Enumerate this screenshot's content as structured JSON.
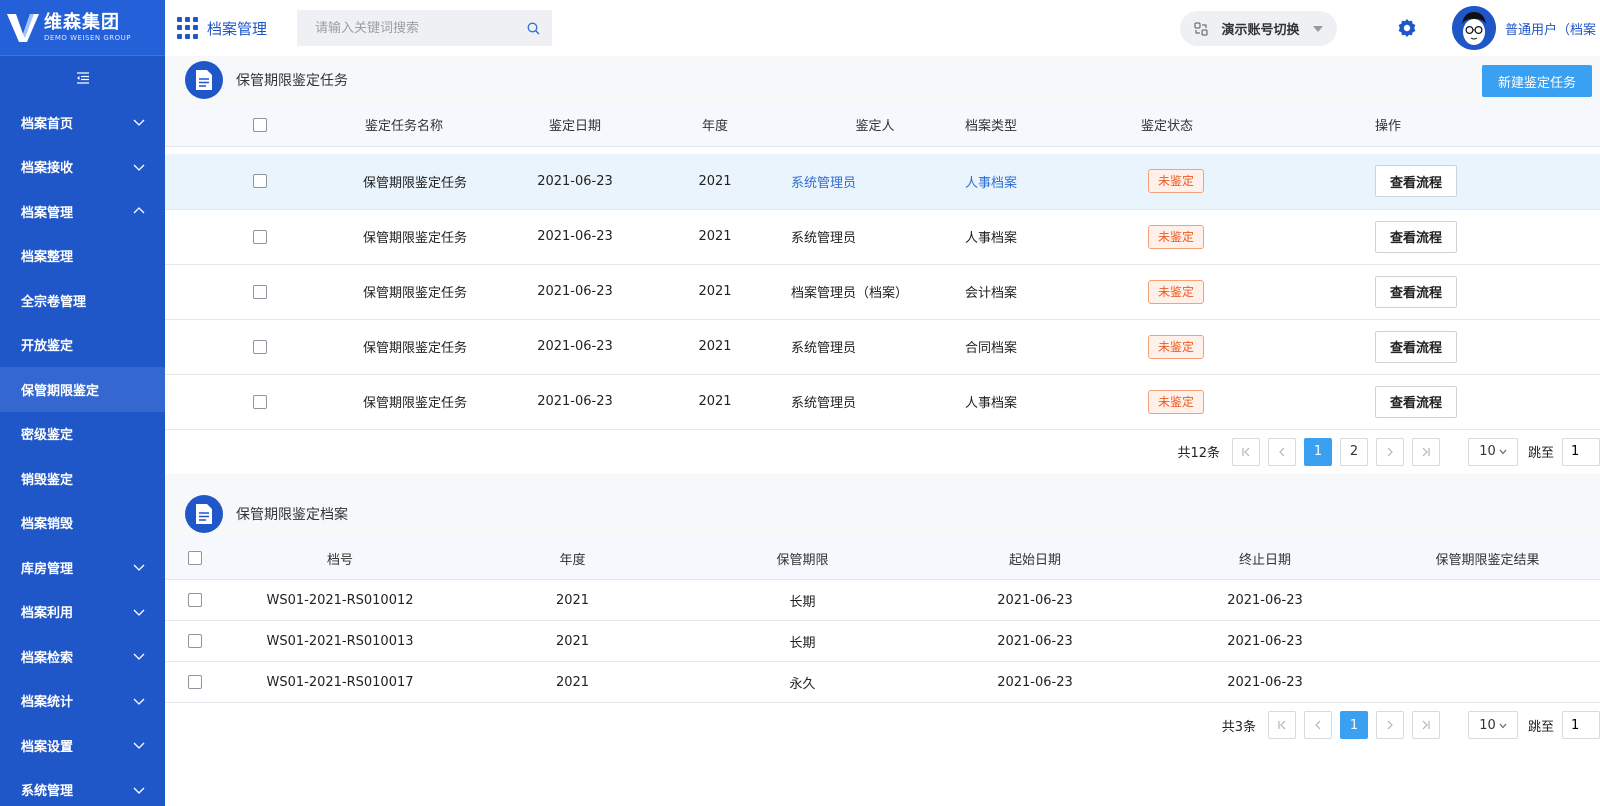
{
  "brand": {
    "name": "维森集团",
    "sub": "DEMO WEISEN GROUP"
  },
  "sidebar": {
    "items": [
      {
        "label": "档案首页",
        "chevron": "down"
      },
      {
        "label": "档案接收",
        "chevron": "down"
      },
      {
        "label": "档案管理",
        "chevron": "up"
      },
      {
        "label": "档案整理",
        "chevron": ""
      },
      {
        "label": "全宗卷管理",
        "chevron": ""
      },
      {
        "label": "开放鉴定",
        "chevron": ""
      },
      {
        "label": "保管期限鉴定",
        "chevron": "",
        "active": true
      },
      {
        "label": "密级鉴定",
        "chevron": ""
      },
      {
        "label": "销毁鉴定",
        "chevron": ""
      },
      {
        "label": "档案销毁",
        "chevron": ""
      },
      {
        "label": "库房管理",
        "chevron": "down"
      },
      {
        "label": "档案利用",
        "chevron": "down"
      },
      {
        "label": "档案检索",
        "chevron": "down"
      },
      {
        "label": "档案统计",
        "chevron": "down"
      },
      {
        "label": "档案设置",
        "chevron": "down"
      },
      {
        "label": "系统管理",
        "chevron": "down"
      }
    ]
  },
  "header": {
    "module_title": "档案管理",
    "search_placeholder": "请输入关键词搜索",
    "account_switch": "演示账号切换",
    "user_name": "普通用户（档案"
  },
  "tasks": {
    "title": "保管期限鉴定任务",
    "new_button": "新建鉴定任务",
    "columns": [
      "鉴定任务名称",
      "鉴定日期",
      "年度",
      "鉴定人",
      "档案类型",
      "鉴定状态",
      "操作"
    ],
    "rows": [
      {
        "name": "保管期限鉴定任务",
        "date": "2021-06-23",
        "year": "2021",
        "person": "系统管理员",
        "type": "人事档案",
        "status": "未鉴定",
        "action": "查看流程"
      },
      {
        "name": "保管期限鉴定任务",
        "date": "2021-06-23",
        "year": "2021",
        "person": "系统管理员",
        "type": "人事档案",
        "status": "未鉴定",
        "action": "查看流程"
      },
      {
        "name": "保管期限鉴定任务",
        "date": "2021-06-23",
        "year": "2021",
        "person": "档案管理员（档案）",
        "type": "会计档案",
        "status": "未鉴定",
        "action": "查看流程"
      },
      {
        "name": "保管期限鉴定任务",
        "date": "2021-06-23",
        "year": "2021",
        "person": "系统管理员",
        "type": "合同档案",
        "status": "未鉴定",
        "action": "查看流程"
      },
      {
        "name": "保管期限鉴定任务",
        "date": "2021-06-23",
        "year": "2021",
        "person": "系统管理员",
        "type": "人事档案",
        "status": "未鉴定",
        "action": "查看流程"
      }
    ],
    "pager": {
      "total": "共12条",
      "pages": [
        "1",
        "2"
      ],
      "current": "1",
      "page_size": "10",
      "jump_label": "跳至",
      "jump_value": "1"
    }
  },
  "archives": {
    "title": "保管期限鉴定档案",
    "columns": [
      "档号",
      "年度",
      "保管期限",
      "起始日期",
      "终止日期",
      "保管期限鉴定结果"
    ],
    "rows": [
      {
        "code": "WS01-2021-RS010012",
        "year": "2021",
        "period": "长期",
        "start": "2021-06-23",
        "end": "2021-06-23",
        "result": ""
      },
      {
        "code": "WS01-2021-RS010013",
        "year": "2021",
        "period": "长期",
        "start": "2021-06-23",
        "end": "2021-06-23",
        "result": ""
      },
      {
        "code": "WS01-2021-RS010017",
        "year": "2021",
        "period": "永久",
        "start": "2021-06-23",
        "end": "2021-06-23",
        "result": ""
      }
    ],
    "pager": {
      "total": "共3条",
      "pages": [
        "1"
      ],
      "current": "1",
      "page_size": "10",
      "jump_label": "跳至",
      "jump_value": "1"
    }
  },
  "colors": {
    "sidebar": "#1f56c8",
    "accent": "#3aa0f2",
    "warn": "#ef5a1f",
    "link": "#2f6ed4"
  }
}
